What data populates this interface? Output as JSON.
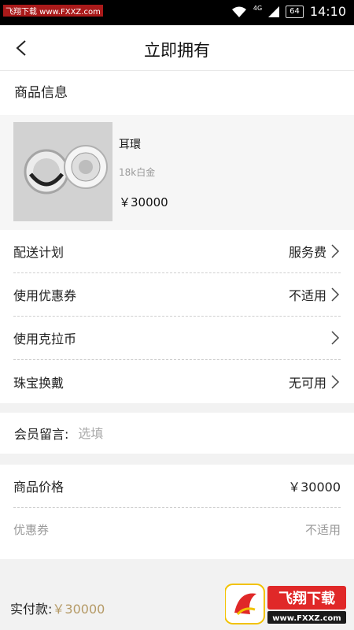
{
  "status_bar": {
    "watermark": "飞翔下载 www.FXXZ.com",
    "network": "4G",
    "battery": "64",
    "time": "14:10"
  },
  "nav": {
    "title": "立即拥有"
  },
  "product_section": {
    "heading": "商品信息",
    "name": "耳環",
    "spec": "18k白金",
    "price": "￥30000"
  },
  "options": [
    {
      "label": "配送计划",
      "value": "服务费"
    },
    {
      "label": "使用优惠券",
      "value": "不适用"
    },
    {
      "label": "使用克拉币",
      "value": ""
    },
    {
      "label": "珠宝换戴",
      "value": "无可用"
    }
  ],
  "memo": {
    "label": "会员留言:",
    "placeholder": "选填"
  },
  "pricing": {
    "price_label": "商品价格",
    "price_value": "￥30000",
    "coupon_label": "优惠券",
    "coupon_value": "不适用"
  },
  "footer": {
    "pay_label": "实付款:",
    "pay_amount": "￥30000"
  },
  "logo": {
    "name": "飞翔下载",
    "url": "www.FXXZ.com"
  },
  "colors": {
    "accent_gold": "#b59a66",
    "logo_red": "#e02828"
  }
}
